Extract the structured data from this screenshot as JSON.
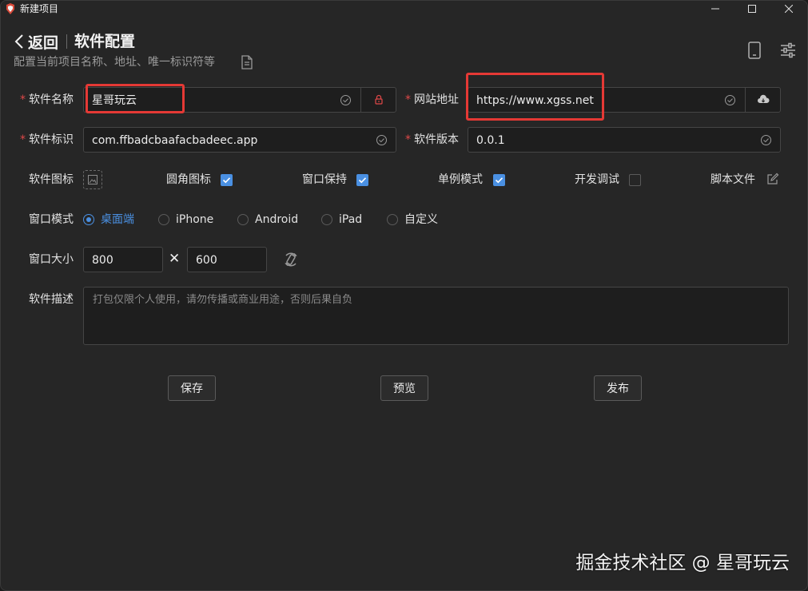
{
  "window": {
    "title": "新建项目",
    "minimize": "—",
    "maximize": "☐",
    "close": "✕"
  },
  "header": {
    "back_label": "返回",
    "title": "软件配置",
    "subtitle": "配置当前项目名称、地址、唯一标识符等"
  },
  "form": {
    "name_label": "软件名称",
    "name_value": "星哥玩云",
    "url_label": "网站地址",
    "url_value": "https://www.xgss.net",
    "id_label": "软件标识",
    "id_value": "com.ffbadcbaafacbadeec.app",
    "version_label": "软件版本",
    "version_value": "0.0.1",
    "required_mark": "*",
    "icon_label": "软件图标",
    "options": [
      {
        "label": "圆角图标",
        "checked": true
      },
      {
        "label": "窗口保持",
        "checked": true
      },
      {
        "label": "单例模式",
        "checked": true
      },
      {
        "label": "开发调试",
        "checked": false
      }
    ],
    "script_label": "脚本文件",
    "window_mode_label": "窗口模式",
    "window_modes": [
      {
        "label": "桌面端",
        "selected": true
      },
      {
        "label": "iPhone",
        "selected": false
      },
      {
        "label": "Android",
        "selected": false
      },
      {
        "label": "iPad",
        "selected": false
      },
      {
        "label": "自定义",
        "selected": false
      }
    ],
    "window_size_label": "窗口大小",
    "width_value": "800",
    "times": "✕",
    "height_value": "600",
    "desc_label": "软件描述",
    "desc_placeholder": "打包仅限个人使用，请勿传播或商业用途，否则后果自负"
  },
  "actions": {
    "save": "保存",
    "preview": "预览",
    "publish": "发布"
  },
  "watermark": "掘金技术社区 @ 星哥玩云",
  "colors": {
    "accent": "#4a90e2",
    "required": "#e04848",
    "highlight_box": "#e53935",
    "background": "#262626"
  }
}
